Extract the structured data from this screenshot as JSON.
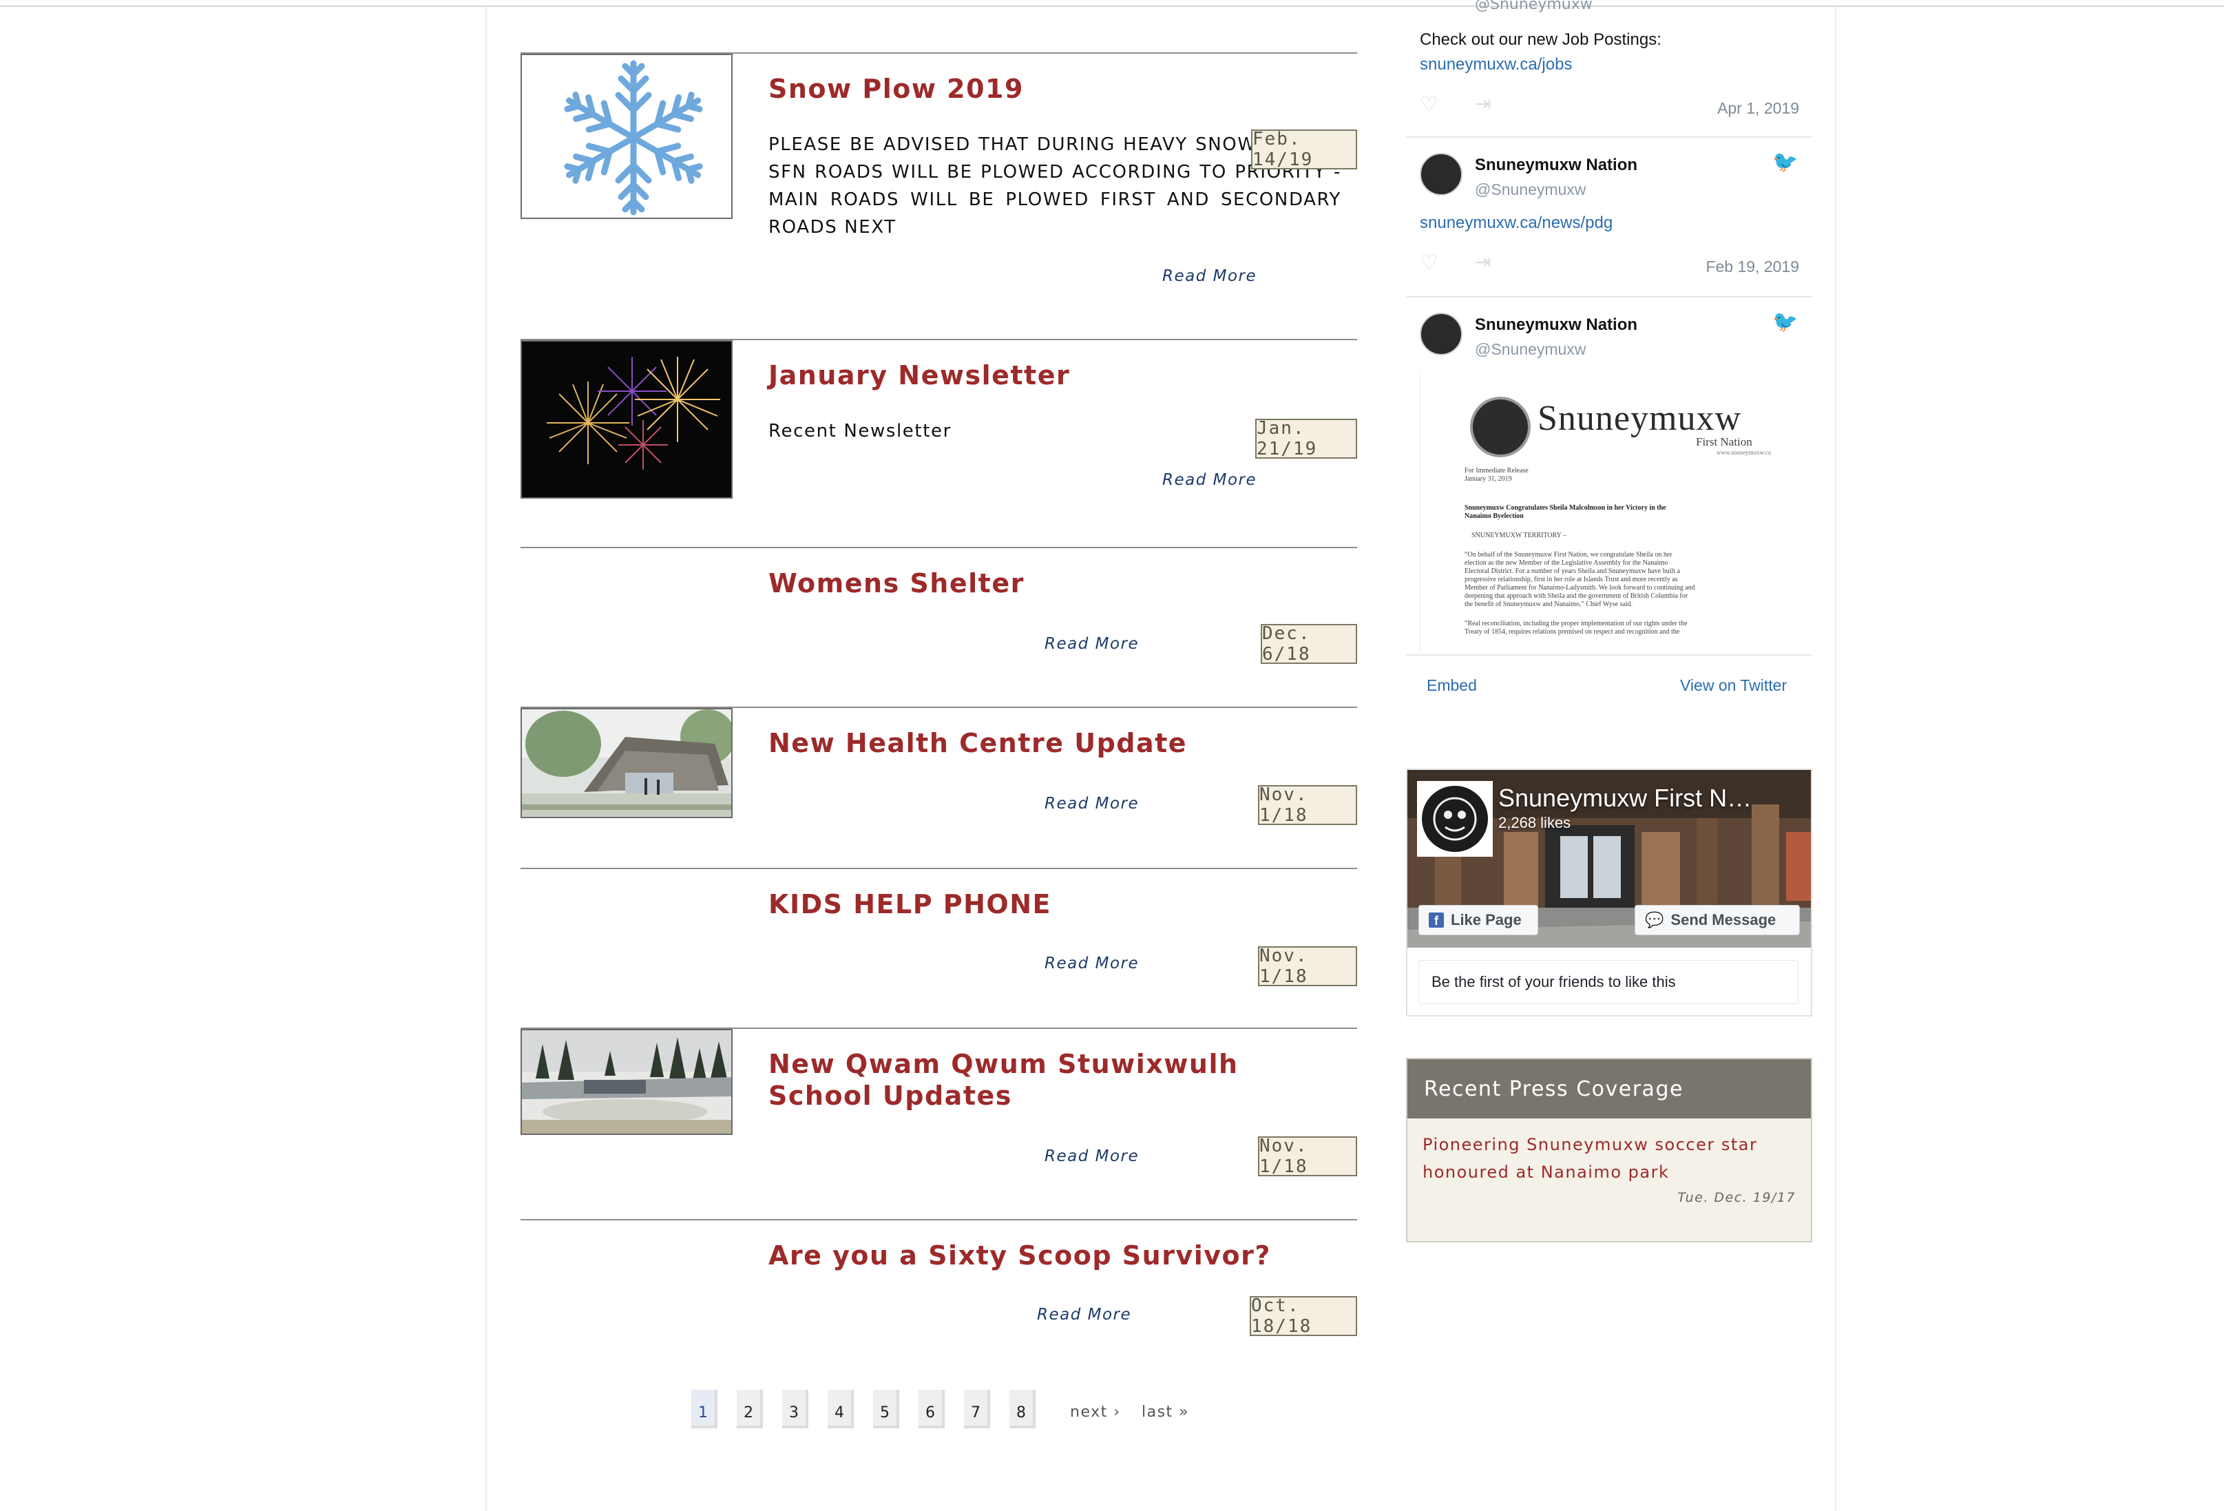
{
  "articles": [
    {
      "title": "Snow Plow 2019",
      "excerpt": "PLEASE BE ADVISED THAT DURING HEAVY SNOW EVENTS SFN ROADS WILL BE PLOWED ACCORDING TO PRIORITY - MAIN ROADS WILL BE PLOWED FIRST AND SECONDARY ROADS NEXT",
      "date": "Feb. 14/19",
      "read_more": "Read More",
      "image": "snowflake"
    },
    {
      "title": "January Newsletter",
      "excerpt": "Recent Newsletter",
      "date": "Jan. 21/19",
      "read_more": "Read More",
      "image": "fireworks"
    },
    {
      "title": "Womens Shelter",
      "excerpt": "",
      "date": "Dec. 6/18",
      "read_more": "Read More",
      "image": ""
    },
    {
      "title": "New Health Centre Update",
      "excerpt": "",
      "date": "Nov. 1/18",
      "read_more": "Read More",
      "image": "health-centre-rendering"
    },
    {
      "title": "KIDS HELP PHONE",
      "excerpt": "",
      "date": "Nov. 1/18",
      "read_more": "Read More",
      "image": ""
    },
    {
      "title": "New Qwam Qwum Stuwixwulh School Updates",
      "excerpt": "",
      "date": "Nov. 1/18",
      "read_more": "Read More",
      "image": "school-rendering"
    },
    {
      "title": "Are you a Sixty Scoop Survivor?",
      "excerpt": "",
      "date": "Oct. 18/18",
      "read_more": "Read More",
      "image": ""
    }
  ],
  "pager": {
    "pages": [
      "1",
      "2",
      "3",
      "4",
      "5",
      "6",
      "7",
      "8"
    ],
    "current": "1",
    "next": "next ›",
    "last": "last »"
  },
  "twitter": {
    "top_handle": "@Snuneymuxw",
    "tweets": [
      {
        "text": "Check out our new Job Postings:",
        "link": "snuneymuxw.ca/jobs",
        "date": "Apr 1, 2019"
      },
      {
        "name": "Snuneymuxw Nation",
        "handle": "@Snuneymuxw",
        "link": "snuneymuxw.ca/news/pdg",
        "date": "Feb 19, 2019"
      },
      {
        "name": "Snuneymuxw Nation",
        "handle": "@Snuneymuxw"
      }
    ],
    "embed": "Embed",
    "view": "View on Twitter",
    "press_release": {
      "brand": "Snuneymuxw",
      "sub": "First Nation",
      "url": "www.snuneymuxw.ca",
      "lines": [
        "For Immediate Release",
        "January 31, 2019",
        "Snuneymuxw Congratulates Sheila Malcolmson in her Victory in the",
        "Nanaimo Byelection",
        "SNUNEYMUXW TERRITORY –",
        "“On behalf of the Snuneymuxw First Nation, we congratulate Sheila on her",
        "election as the new Member of the Legislative Assembly for the Nanaimo",
        "Electoral District. For a number of years Sheila and Snuneymuxw have built a",
        "progressive relationship, first in her role at Islands Trust and more recently as",
        "Member of Parliament for Nanaimo-Ladysmith. We look forward to continuing and",
        "deepening that approach with Sheila and the government of British Columbia for",
        "the benefit of Snuneymuxw and Nanaimo,” Chief Wyse said.",
        "“Real reconciliation, including the proper implementation of our rights under the",
        "Treaty of 1854, requires relations premised on respect and recognition and the"
      ]
    }
  },
  "facebook": {
    "page_name": "Snuneymuxw First N…",
    "likes": "2,268 likes",
    "like_button": "Like Page",
    "message_button": "Send Message",
    "friends_text": "Be the first of your friends to like this"
  },
  "press": {
    "heading": "Recent Press Coverage",
    "link": "Pioneering Snuneymuxw soccer star honoured at Nanaimo park",
    "date": "Tue. Dec. 19/17"
  },
  "colors": {
    "title": "#9d2a2a",
    "link_blue": "#2b6db0",
    "read_more": "#1d3a6a",
    "press_header": "#7a756c"
  }
}
